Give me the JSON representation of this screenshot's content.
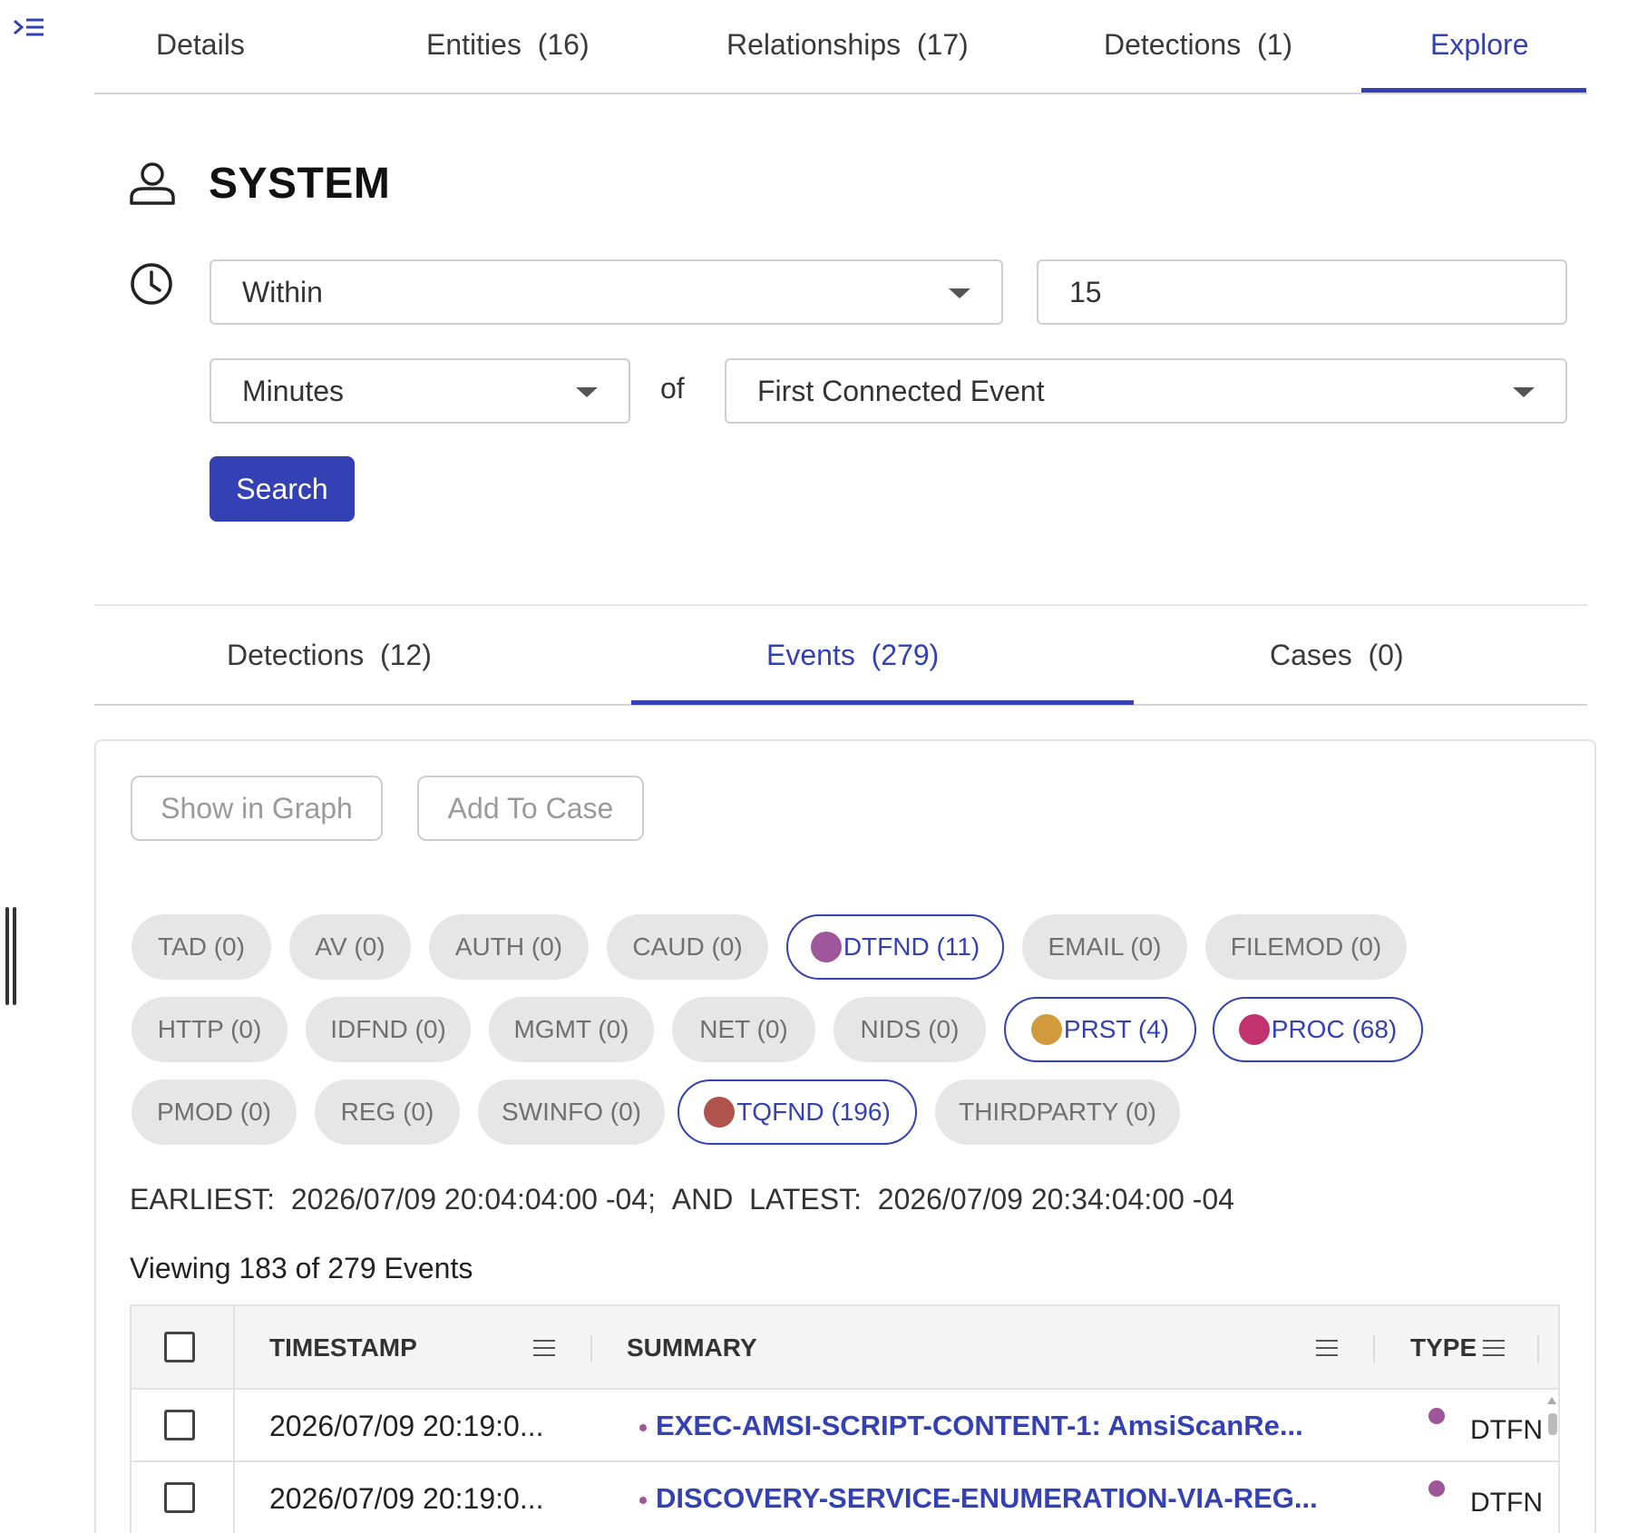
{
  "nav": {
    "tabs": [
      {
        "label": "Details"
      },
      {
        "label": "Entities",
        "count": "(16)"
      },
      {
        "label": "Relationships",
        "count": "(17)"
      },
      {
        "label": "Detections",
        "count": "(1)"
      },
      {
        "label": "Explore"
      }
    ],
    "active": "Explore"
  },
  "entity": {
    "title": "SYSTEM",
    "icon": "user-icon"
  },
  "filter": {
    "condition": "Within",
    "amount": "15",
    "unit": "Minutes",
    "of_label": "of",
    "anchor": "First Connected Event",
    "search_label": "Search"
  },
  "sub_tabs": [
    {
      "label": "Detections",
      "count": "(12)"
    },
    {
      "label": "Events",
      "count": "(279)"
    },
    {
      "label": "Cases",
      "count": "(0)"
    }
  ],
  "actions": {
    "show_in_graph": "Show in Graph",
    "add_to_case": "Add To Case"
  },
  "chips": [
    {
      "label": "TAD (0)",
      "active": false
    },
    {
      "label": "AV (0)",
      "active": false
    },
    {
      "label": "AUTH (0)",
      "active": false
    },
    {
      "label": "CAUD (0)",
      "active": false
    },
    {
      "label": "DTFND (11)",
      "active": true,
      "color": "#a0569a"
    },
    {
      "label": "EMAIL (0)",
      "active": false
    },
    {
      "label": "FILEMOD (0)",
      "active": false
    },
    {
      "label": "HTTP (0)",
      "active": false
    },
    {
      "label": "IDFND (0)",
      "active": false
    },
    {
      "label": "MGMT (0)",
      "active": false
    },
    {
      "label": "NET (0)",
      "active": false
    },
    {
      "label": "NIDS (0)",
      "active": false
    },
    {
      "label": "PRST (4)",
      "active": true,
      "color": "#d19a3d"
    },
    {
      "label": "PROC (68)",
      "active": true,
      "color": "#c2326f"
    },
    {
      "label": "PMOD (0)",
      "active": false
    },
    {
      "label": "REG (0)",
      "active": false
    },
    {
      "label": "SWINFO (0)",
      "active": false
    },
    {
      "label": "TQFND (196)",
      "active": true,
      "color": "#b0524d"
    },
    {
      "label": "THIRDPARTY (0)",
      "active": false
    }
  ],
  "range": {
    "earliest_label": "EARLIEST:",
    "earliest": "2026/07/09 20:04:04:00 -04;",
    "and": "AND",
    "latest_label": "LATEST:",
    "latest": "2026/07/09 20:34:04:00 -04"
  },
  "viewing": "Viewing 183 of 279 Events",
  "table": {
    "columns": [
      "TIMESTAMP",
      "SUMMARY",
      "TYPE"
    ],
    "rows": [
      {
        "timestamp": "2026/07/09 20:19:0...",
        "summary": "EXEC-AMSI-SCRIPT-CONTENT-1: AmsiScanRe...",
        "type": "DTFN"
      },
      {
        "timestamp": "2026/07/09 20:19:0...",
        "summary": "DISCOVERY-SERVICE-ENUMERATION-VIA-REG...",
        "type": "DTFN"
      }
    ]
  },
  "colors": {
    "accent": "#3441b5",
    "dtfnd": "#a0569a"
  }
}
